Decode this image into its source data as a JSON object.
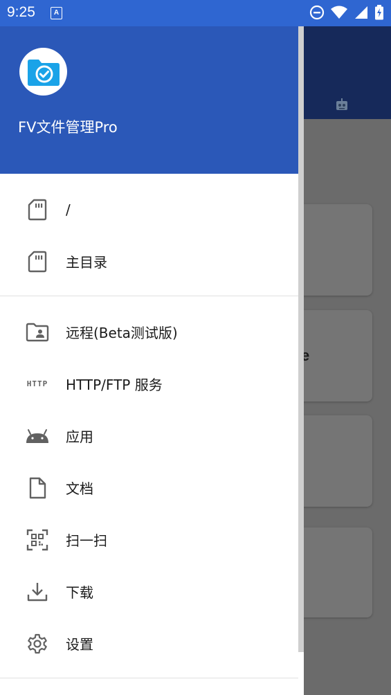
{
  "status_bar": {
    "time": "9:25",
    "notification_icon": "A"
  },
  "drawer": {
    "app_name": "FV文件管理Pro",
    "logo_icon": "folder-check-icon",
    "section1": [
      {
        "label": "/",
        "icon": "sd-card-icon"
      },
      {
        "label": "主目录",
        "icon": "sd-card-icon"
      }
    ],
    "section2": [
      {
        "label": "远程(Beta测试版)",
        "icon": "folder-user-icon"
      },
      {
        "label": "HTTP/FTP 服务",
        "icon": "http-icon",
        "icon_text": "HTTP"
      },
      {
        "label": "应用",
        "icon": "android-icon"
      },
      {
        "label": "文档",
        "icon": "document-icon"
      },
      {
        "label": "扫一扫",
        "icon": "qr-scan-icon"
      },
      {
        "label": "下载",
        "icon": "download-icon"
      },
      {
        "label": "设置",
        "icon": "gear-icon"
      }
    ]
  },
  "background": {
    "partial_text": "e"
  },
  "colors": {
    "status_bar": "#2f66d1",
    "drawer_header": "#2b58b8",
    "logo_folder": "#1aa3e8",
    "icon_gray": "#616161",
    "scrim": "#6b6b6b"
  }
}
